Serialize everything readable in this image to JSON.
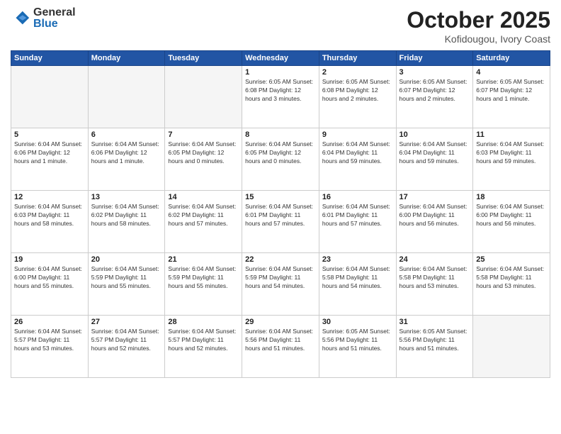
{
  "header": {
    "logo_general": "General",
    "logo_blue": "Blue",
    "month": "October 2025",
    "location": "Kofidougou, Ivory Coast"
  },
  "weekdays": [
    "Sunday",
    "Monday",
    "Tuesday",
    "Wednesday",
    "Thursday",
    "Friday",
    "Saturday"
  ],
  "weeks": [
    [
      {
        "day": "",
        "info": ""
      },
      {
        "day": "",
        "info": ""
      },
      {
        "day": "",
        "info": ""
      },
      {
        "day": "1",
        "info": "Sunrise: 6:05 AM\nSunset: 6:08 PM\nDaylight: 12 hours and 3 minutes."
      },
      {
        "day": "2",
        "info": "Sunrise: 6:05 AM\nSunset: 6:08 PM\nDaylight: 12 hours and 2 minutes."
      },
      {
        "day": "3",
        "info": "Sunrise: 6:05 AM\nSunset: 6:07 PM\nDaylight: 12 hours and 2 minutes."
      },
      {
        "day": "4",
        "info": "Sunrise: 6:05 AM\nSunset: 6:07 PM\nDaylight: 12 hours and 1 minute."
      }
    ],
    [
      {
        "day": "5",
        "info": "Sunrise: 6:04 AM\nSunset: 6:06 PM\nDaylight: 12 hours and 1 minute."
      },
      {
        "day": "6",
        "info": "Sunrise: 6:04 AM\nSunset: 6:06 PM\nDaylight: 12 hours and 1 minute."
      },
      {
        "day": "7",
        "info": "Sunrise: 6:04 AM\nSunset: 6:05 PM\nDaylight: 12 hours and 0 minutes."
      },
      {
        "day": "8",
        "info": "Sunrise: 6:04 AM\nSunset: 6:05 PM\nDaylight: 12 hours and 0 minutes."
      },
      {
        "day": "9",
        "info": "Sunrise: 6:04 AM\nSunset: 6:04 PM\nDaylight: 11 hours and 59 minutes."
      },
      {
        "day": "10",
        "info": "Sunrise: 6:04 AM\nSunset: 6:04 PM\nDaylight: 11 hours and 59 minutes."
      },
      {
        "day": "11",
        "info": "Sunrise: 6:04 AM\nSunset: 6:03 PM\nDaylight: 11 hours and 59 minutes."
      }
    ],
    [
      {
        "day": "12",
        "info": "Sunrise: 6:04 AM\nSunset: 6:03 PM\nDaylight: 11 hours and 58 minutes."
      },
      {
        "day": "13",
        "info": "Sunrise: 6:04 AM\nSunset: 6:02 PM\nDaylight: 11 hours and 58 minutes."
      },
      {
        "day": "14",
        "info": "Sunrise: 6:04 AM\nSunset: 6:02 PM\nDaylight: 11 hours and 57 minutes."
      },
      {
        "day": "15",
        "info": "Sunrise: 6:04 AM\nSunset: 6:01 PM\nDaylight: 11 hours and 57 minutes."
      },
      {
        "day": "16",
        "info": "Sunrise: 6:04 AM\nSunset: 6:01 PM\nDaylight: 11 hours and 57 minutes."
      },
      {
        "day": "17",
        "info": "Sunrise: 6:04 AM\nSunset: 6:00 PM\nDaylight: 11 hours and 56 minutes."
      },
      {
        "day": "18",
        "info": "Sunrise: 6:04 AM\nSunset: 6:00 PM\nDaylight: 11 hours and 56 minutes."
      }
    ],
    [
      {
        "day": "19",
        "info": "Sunrise: 6:04 AM\nSunset: 6:00 PM\nDaylight: 11 hours and 55 minutes."
      },
      {
        "day": "20",
        "info": "Sunrise: 6:04 AM\nSunset: 5:59 PM\nDaylight: 11 hours and 55 minutes."
      },
      {
        "day": "21",
        "info": "Sunrise: 6:04 AM\nSunset: 5:59 PM\nDaylight: 11 hours and 55 minutes."
      },
      {
        "day": "22",
        "info": "Sunrise: 6:04 AM\nSunset: 5:59 PM\nDaylight: 11 hours and 54 minutes."
      },
      {
        "day": "23",
        "info": "Sunrise: 6:04 AM\nSunset: 5:58 PM\nDaylight: 11 hours and 54 minutes."
      },
      {
        "day": "24",
        "info": "Sunrise: 6:04 AM\nSunset: 5:58 PM\nDaylight: 11 hours and 53 minutes."
      },
      {
        "day": "25",
        "info": "Sunrise: 6:04 AM\nSunset: 5:58 PM\nDaylight: 11 hours and 53 minutes."
      }
    ],
    [
      {
        "day": "26",
        "info": "Sunrise: 6:04 AM\nSunset: 5:57 PM\nDaylight: 11 hours and 53 minutes."
      },
      {
        "day": "27",
        "info": "Sunrise: 6:04 AM\nSunset: 5:57 PM\nDaylight: 11 hours and 52 minutes."
      },
      {
        "day": "28",
        "info": "Sunrise: 6:04 AM\nSunset: 5:57 PM\nDaylight: 11 hours and 52 minutes."
      },
      {
        "day": "29",
        "info": "Sunrise: 6:04 AM\nSunset: 5:56 PM\nDaylight: 11 hours and 51 minutes."
      },
      {
        "day": "30",
        "info": "Sunrise: 6:05 AM\nSunset: 5:56 PM\nDaylight: 11 hours and 51 minutes."
      },
      {
        "day": "31",
        "info": "Sunrise: 6:05 AM\nSunset: 5:56 PM\nDaylight: 11 hours and 51 minutes."
      },
      {
        "day": "",
        "info": ""
      }
    ]
  ]
}
